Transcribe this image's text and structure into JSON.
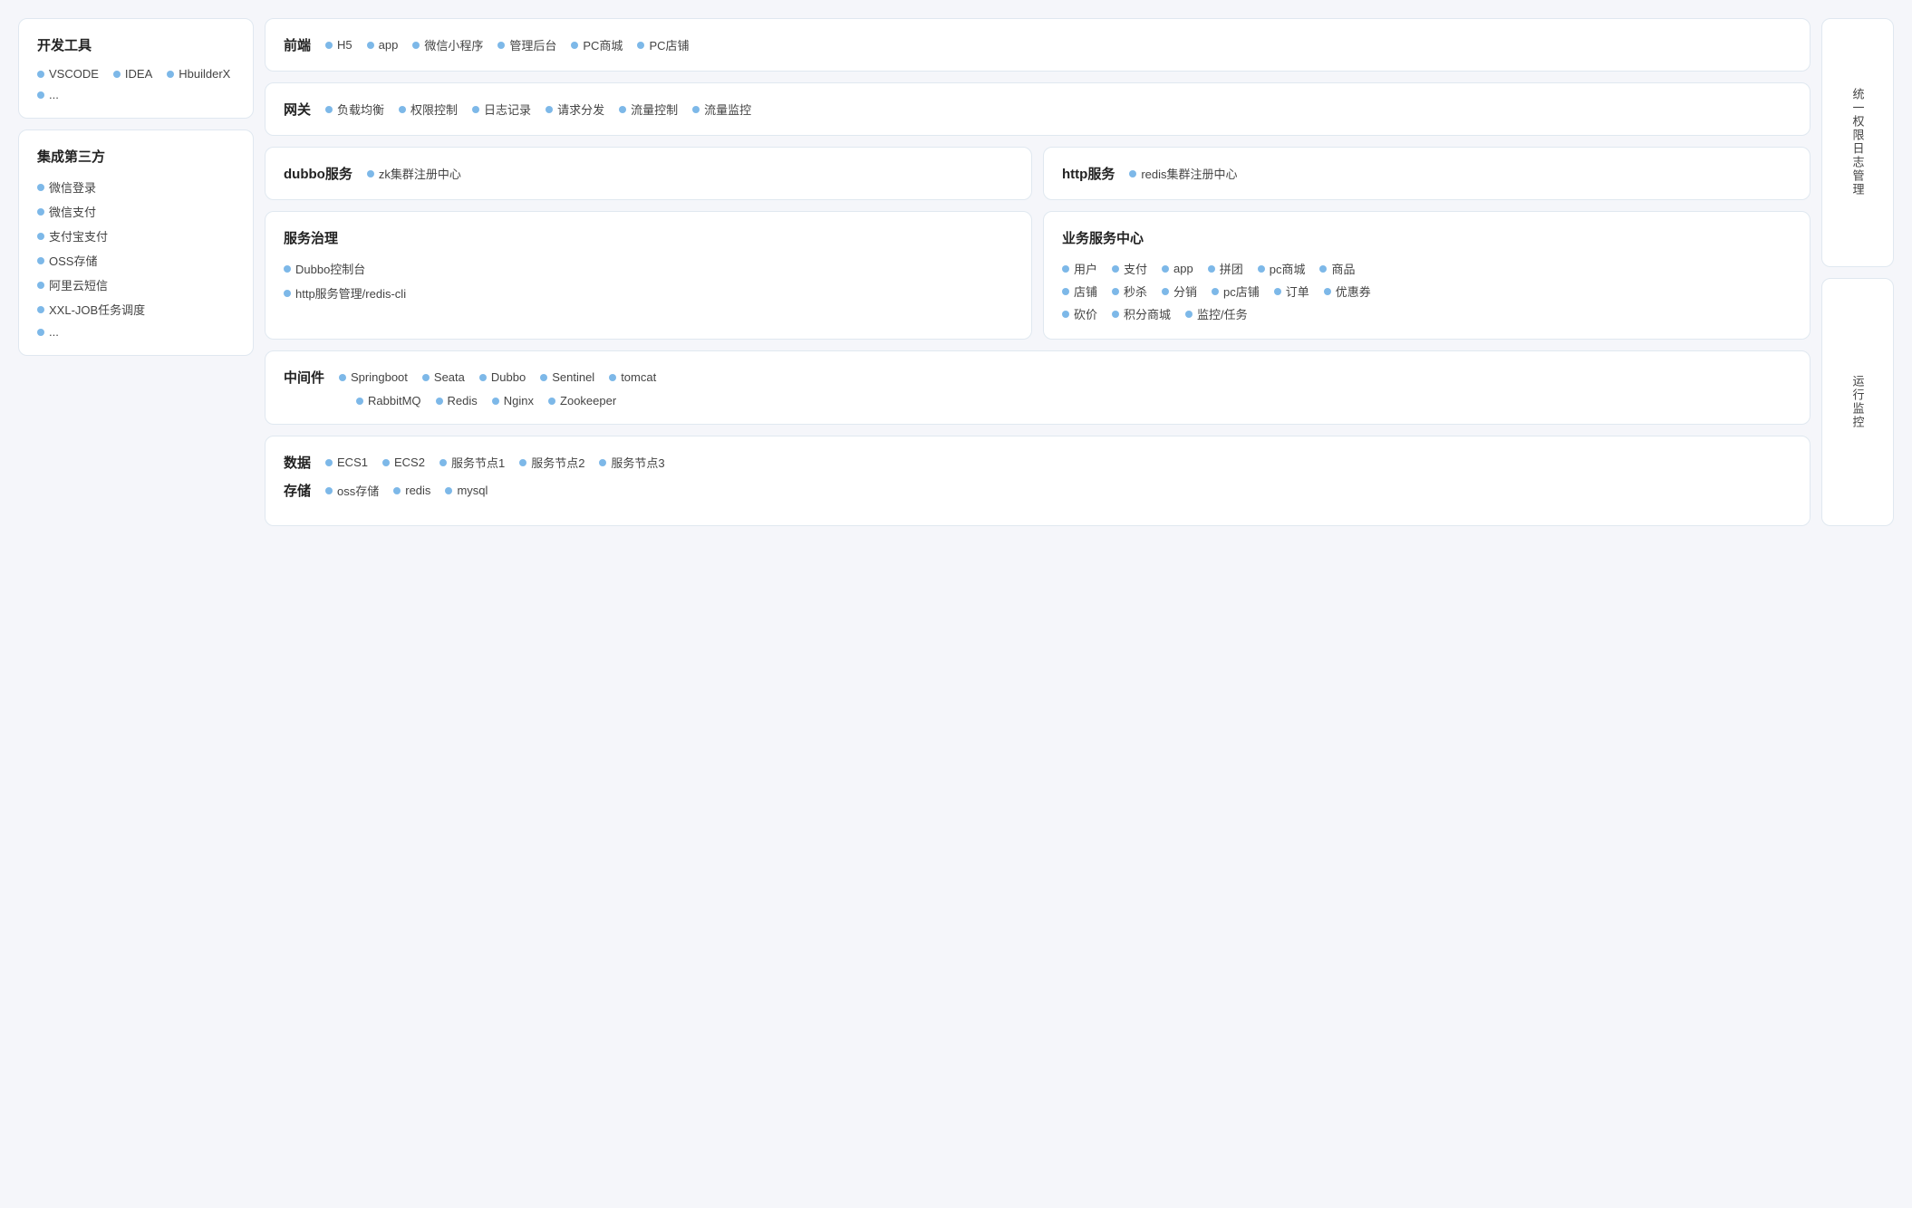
{
  "leftCol": {
    "devTools": {
      "title": "开发工具",
      "items": [
        "VSCODE",
        "IDEA",
        "HbuilderX",
        "..."
      ]
    },
    "thirdParty": {
      "title": "集成第三方",
      "items": [
        "微信登录",
        "微信支付",
        "支付宝支付",
        "OSS存储",
        "阿里云短信",
        "XXL-JOB任务调度",
        "..."
      ]
    }
  },
  "centerCol": {
    "frontend": {
      "label": "前端",
      "items": [
        "H5",
        "app",
        "微信小程序",
        "管理后台",
        "PC商城",
        "PC店铺"
      ]
    },
    "gateway": {
      "label": "网关",
      "items": [
        "负载均衡",
        "权限控制",
        "日志记录",
        "请求分发",
        "流量控制",
        "流量监控"
      ]
    },
    "dubboService": {
      "label": "dubbo服务",
      "items": [
        "zk集群注册中心"
      ]
    },
    "httpService": {
      "label": "http服务",
      "items": [
        "redis集群注册中心"
      ]
    },
    "governance": {
      "title": "服务治理",
      "items": [
        "Dubbo控制台",
        "http服务管理/redis-cli"
      ]
    },
    "bizCenter": {
      "title": "业务服务中心",
      "rows": [
        [
          "用户",
          "支付",
          "app",
          "拼团",
          "pc商城",
          "商品"
        ],
        [
          "店铺",
          "秒杀",
          "分销",
          "pc店铺",
          "订单",
          "优惠券"
        ],
        [
          "砍价",
          "积分商城",
          "监控/任务"
        ]
      ]
    },
    "middleware": {
      "label": "中间件",
      "row1": [
        "Springboot",
        "Seata",
        "Dubbo",
        "Sentinel",
        "tomcat"
      ],
      "row2": [
        "RabbitMQ",
        "Redis",
        "Nginx",
        "Zookeeper"
      ]
    },
    "dataStorage": {
      "dataLabel": "数据",
      "dataItems": [
        "ECS1",
        "ECS2",
        "服务节点1",
        "服务节点2",
        "服务节点3"
      ],
      "storageLabel": "存储",
      "storageItems": [
        "oss存储",
        "redis",
        "mysql"
      ]
    }
  },
  "rightCol": {
    "unified": "统一权限日志管理",
    "monitoring": "运行监控"
  }
}
